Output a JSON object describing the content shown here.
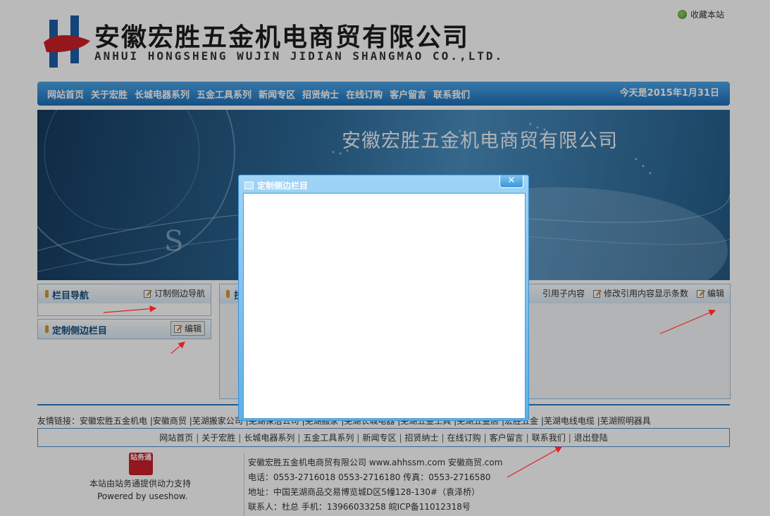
{
  "header": {
    "company_cn": "安徽宏胜五金机电商贸有限公司",
    "company_en": "ANHUI HONGSHENG WUJIN JIDIAN SHANGMAO CO.,LTD.",
    "favorite": "收藏本站"
  },
  "nav": {
    "items": [
      "网站首页",
      "关于宏胜",
      "长城电器系列",
      "五金工具系列",
      "新闻专区",
      "招贤纳士",
      "在线订购",
      "客户留言",
      "联系我们"
    ],
    "date": "今天是2015年1月31日"
  },
  "banner": {
    "title": "安徽宏胜五金机电商贸有限公司"
  },
  "sidebar": {
    "nav_box": {
      "title": "栏目导航",
      "action": "订制侧边导航"
    },
    "custom_box": {
      "title": "定制侧边栏目",
      "action": "编辑"
    }
  },
  "main_box": {
    "title_partial": "技",
    "actions": [
      "引用子内容",
      "修改引用内容显示条数",
      "编辑"
    ]
  },
  "footer": {
    "friend_links_label": "友情链接：",
    "friend_links": [
      "安徽宏胜五金机电",
      "安徽商贸",
      "芜湖搬家公司",
      "芜湖保洁公司",
      "芜湖搬家",
      "芜湖长城电器",
      "芜湖五金工具",
      "芜湖五金店",
      "宏胜五金",
      "芜湖电线电缆",
      "芜湖照明器具"
    ],
    "nav": [
      "网站首页",
      "关于宏胜",
      "长城电器系列",
      "五金工具系列",
      "新闻专区",
      "招贤纳士",
      "在线订购",
      "客户留言",
      "联系我们",
      "退出登陆"
    ],
    "support_logo": "站务通",
    "support_cn": "本站由站务通提供动力支持",
    "support_en": "Powered by useshow.",
    "info_lines": [
      "安徽宏胜五金机电商贸有限公司    www.ahhssm.com    安徽商贸.com",
      "电话：0553-2716018    0553-2716180    传真：0553-2716580",
      "地址：中国芜湖商品交易博览城D区5幢128-130#（袁泽桥）",
      "联系人：杜总    手机：13966033258    皖ICP备11012318号"
    ]
  },
  "dialog": {
    "title": "定制侧边栏目",
    "close": "✕"
  },
  "colors": {
    "nav_blue": "#1d6fb8",
    "dialog_blue": "#5cb0ea",
    "arrow_red": "#e02020"
  }
}
